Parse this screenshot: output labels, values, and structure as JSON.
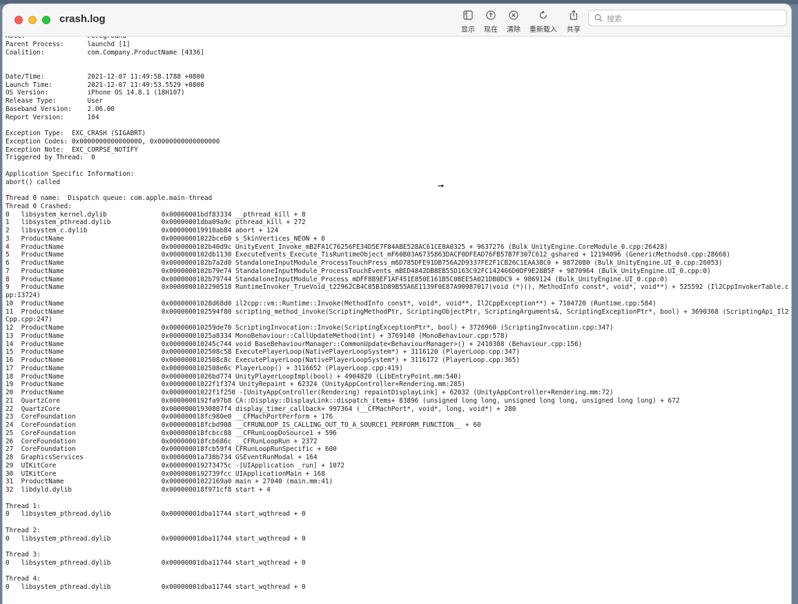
{
  "window": {
    "title": "crash.log",
    "traffic_lights": {
      "close": "#fe5f57",
      "minimize": "#febc2e",
      "maximize": "#28c840"
    }
  },
  "toolbar": {
    "show_label": "显示",
    "now_label": "现在",
    "clear_label": "清除",
    "reload_label": "重新载入",
    "share_label": "共享"
  },
  "search": {
    "placeholder": "搜索",
    "value": ""
  },
  "log": {
    "text": "Role:                Foreground\nParent Process:      launchd [1]\nCoalition:           com.Company.ProductName [4336]\n\n\nDate/Time:           2021-12-07 11:49:58.1788 +0800\nLaunch Time:         2021-12-07 11:49:53.5529 +0800\nOS Version:          iPhone OS 14.8.1 (18H107)\nRelease Type:        User\nBaseband Version:    2.06.00\nReport Version:      104\n\nException Type:  EXC_CRASH (SIGABRT)\nException Codes: 0x0000000000000000, 0x0000000000000000\nException Note:  EXC_CORPSE_NOTIFY\nTriggered by Thread:  0\n\nApplication Specific Information:\nabort() called\n\nThread 0 name:  Dispatch queue: com.apple.main-thread\nThread 0 Crashed:\n0   libsystem_kernel.dylib        \t0x00000001bdf83334 __pthread_kill + 8\n1   libsystem_pthread.dylib       \t0x00000001dba09a9c pthread_kill + 272\n2   libsystem_c.dylib             \t0x000000019910ab84 abort + 124\n3   ProductName                   \t0x00000001022bceb0 s_SkinVertices_NEON + 0\n4   ProductName                   \t0x0000000102b40d9c UnityEvent_Invoke_mB2FA1C76256FE34D5E7F84ABE528AC61CE8A0325 + 9637276 (Bulk_UnityEngine.CoreModule_0.cpp:26428)\n5   ProductName                   \t0x0000000102db1130 ExecuteEvents_Execute_TisRuntimeObject_mF60B03A6735863DACF0DFEAD76FB57B7F307C612_gshared + 12194096 (GenericMethods0.cpp:28668)\n6   ProductName                   \t0x0000000102b7a2d0 StandaloneInputModule_ProcessTouchPress_m6D785DFE91DB756A2D9337FE2F1CB26C1EAA38C0 + 9872080 (Bulk_UnityEngine.UI_0.cpp:26053)\n7   ProductName                   \t0x0000000102b79e74 StandaloneInputModule_ProcessTouchEvents_mBED4842DB8EB55D163C92FC142466D0DF9E28B5F + 9870964 (Bulk_UnityEngine.UI_0.cpp:0)\n8   ProductName                   \t0x0000000102b79744 StandaloneInputModule_Process_mDFF8B9EF1AF451E850E161B5C0BEE5A021DB0DC9 + 9869124 (Bulk_UnityEngine.UI_0.cpp:0)\n9   ProductName                   \t0x0000000102290518 RuntimeInvoker_TrueVoid_t22962CB4C05B1D89B55A6E1139F0E87A90987017(void (*)(), MethodInfo const*, void*, void**) + 525592 (Il2CppInvokerTable.cpp:13724)\n10  ProductName                   \t0x00000001028d68d0 il2cpp::vm::Runtime::Invoke(MethodInfo const*, void*, void**, Il2CppException**) + 7104720 (Runtime.cpp:584)\n11  ProductName                   \t0x0000000102594f80 scripting_method_invoke(ScriptingMethodPtr, ScriptingObjectPtr, ScriptingArguments&, ScriptingExceptionPtr*, bool) + 3690368 (ScriptingApi_Il2Cpp.cpp:247)\n12  ProductName                   \t0x000000010259de70 ScriptingInvocation::Invoke(ScriptingExceptionPtr*, bool) + 3726960 (ScriptingInvocation.cpp:347)\n13  ProductName                   \t0x00000001025a8334 MonoBehaviour::CallUpdateMethod(int) + 3769140 (MonoBehaviour.cpp:578)\n14  ProductName                   \t0x000000010245c744 void BaseBehaviourManager::CommonUpdate<BehaviourManager>() + 2410308 (Behaviour.cpp:156)\n15  ProductName                   \t0x0000000102508c58 ExecutePlayerLoop(NativePlayerLoopSystem*) + 3116120 (PlayerLoop.cpp:347)\n16  ProductName                   \t0x0000000102508c8c ExecutePlayerLoop(NativePlayerLoopSystem*) + 3116172 (PlayerLoop.cpp:365)\n17  ProductName                   \t0x0000000102508e6c PlayerLoop() + 3116652 (PlayerLoop.cpp:419)\n18  ProductName                   \t0x00000001026bd774 UnityPlayerLoopImpl(bool) + 4904820 (LibEntryPoint.mm:540)\n19  ProductName                   \t0x00000001022f1f374 UnityRepaint + 62324 (UnityAppController+Rendering.mm:285)\n20  ProductName                   \t0x00000001022f1f250 -[UnityAppController(Rendering) repaintDisplayLink] + 62032 (UnityAppController+Rendering.mm:72)\n21  QuartzCore                    \t0x0000000192fa97b8 CA::Display::DisplayLink::dispatch_items+ 83896 (unsigned long long, unsigned long long, unsigned long long) + 672\n22  QuartzCore                    \t0x00000001930887f4 display_timer_callback+ 997364 (__CFMachPort*, void*, long, void*) + 280\n23  CoreFoundation                \t0x000000018fc980e0 __CFMachPortPerform + 176\n24  CoreFoundation                \t0x000000018fcbd908 __CFRUNLOOP_IS_CALLING_OUT_TO_A_SOURCE1_PERFORM_FUNCTION__ + 60\n25  CoreFoundation                \t0x000000018fcbcc88 __CFRunLoopDoSource1 + 596\n26  CoreFoundation                \t0x000000018fcb686c __CFRunLoopRun + 2372\n27  CoreFoundation                \t0x000000018fcb59f4 CFRunLoopRunSpecific + 600\n28  GraphicsServices              \t0x00000001a738b734 GSEventRunModal + 164\n29  UIKitCore                     \t0x000000019273475c -[UIApplication _run] + 1072\n30  UIKitCore                     \t0x0000000192739fcc UIApplicationMain + 168\n31  ProductName                   \t0x00000001022169a0 main + 27040 (main.mm:41)\n32  libdyld.dylib                 \t0x000000018f971cf8 start + 4\n\nThread 1:\n0   libsystem_pthread.dylib       \t0x00000001dba11744 start_wqthread + 0\n\nThread 2:\n0   libsystem_pthread.dylib       \t0x00000001dba11744 start_wqthread + 0\n\nThread 3:\n0   libsystem_pthread.dylib       \t0x00000001dba11744 start_wqthread + 0\n\nThread 4:\n0   libsystem_pthread.dylib       \t0x00000001dba11744 start_wqthread + 0"
  },
  "colors": {
    "desktop": "#6e7f96",
    "titlebar": "#f6f6f6",
    "text": "#1a1a1a"
  },
  "icons": {
    "show": "sidebar-icon",
    "now": "clock-arrow-icon",
    "clear": "clear-x-icon",
    "reload": "reload-icon",
    "share": "share-icon",
    "search": "magnifier-icon"
  }
}
